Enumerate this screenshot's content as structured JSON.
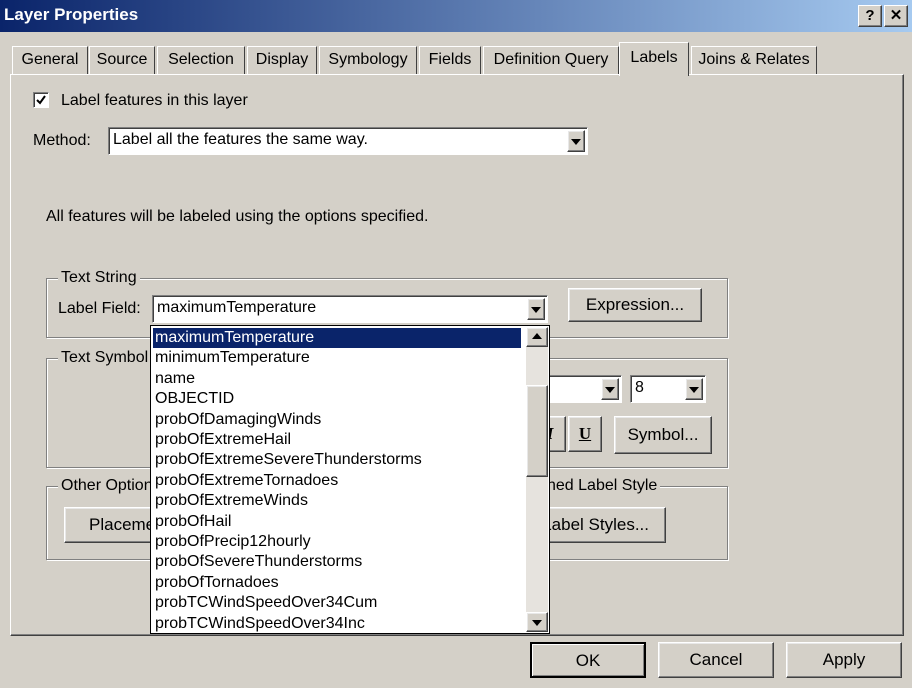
{
  "window": {
    "title": "Layer Properties",
    "help_label": "?",
    "close_label": "✕"
  },
  "tabs": [
    "General",
    "Source",
    "Selection",
    "Display",
    "Symbology",
    "Fields",
    "Definition Query",
    "Labels",
    "Joins & Relates"
  ],
  "active_tab": "Labels",
  "labels_tab": {
    "label_features": "Label features in this layer",
    "method_label": "Method:",
    "method_value": "Label all the features the same way.",
    "description": "All features will be labeled using the options specified.",
    "text_string": {
      "legend": "Text String",
      "label_field_label": "Label Field:",
      "label_field_value": "maximumTemperature",
      "expression_button": "Expression..."
    },
    "text_symbol": {
      "legend": "Text Symbol",
      "size_value": "8",
      "underline_label": "U",
      "italic_label": "I",
      "symbol_button": "Symbol..."
    },
    "other_options": {
      "legend": "Other Option",
      "placement_button": "Placeme"
    },
    "predefined": {
      "legend": "ned Label Style",
      "label_styles_button": "Label Styles..."
    }
  },
  "dropdown_items": [
    "maximumTemperature",
    "minimumTemperature",
    "name",
    "OBJECTID",
    "probOfDamagingWinds",
    "probOfExtremeHail",
    "probOfExtremeSevereThunderstorms",
    "probOfExtremeTornadoes",
    "probOfExtremeWinds",
    "probOfHail",
    "probOfPrecip12hourly",
    "probOfSevereThunderstorms",
    "probOfTornadoes",
    "probTCWindSpeedOver34Cum",
    "probTCWindSpeedOver34Inc"
  ],
  "dropdown_selected": 0,
  "footer": {
    "ok": "OK",
    "cancel": "Cancel",
    "apply": "Apply"
  }
}
